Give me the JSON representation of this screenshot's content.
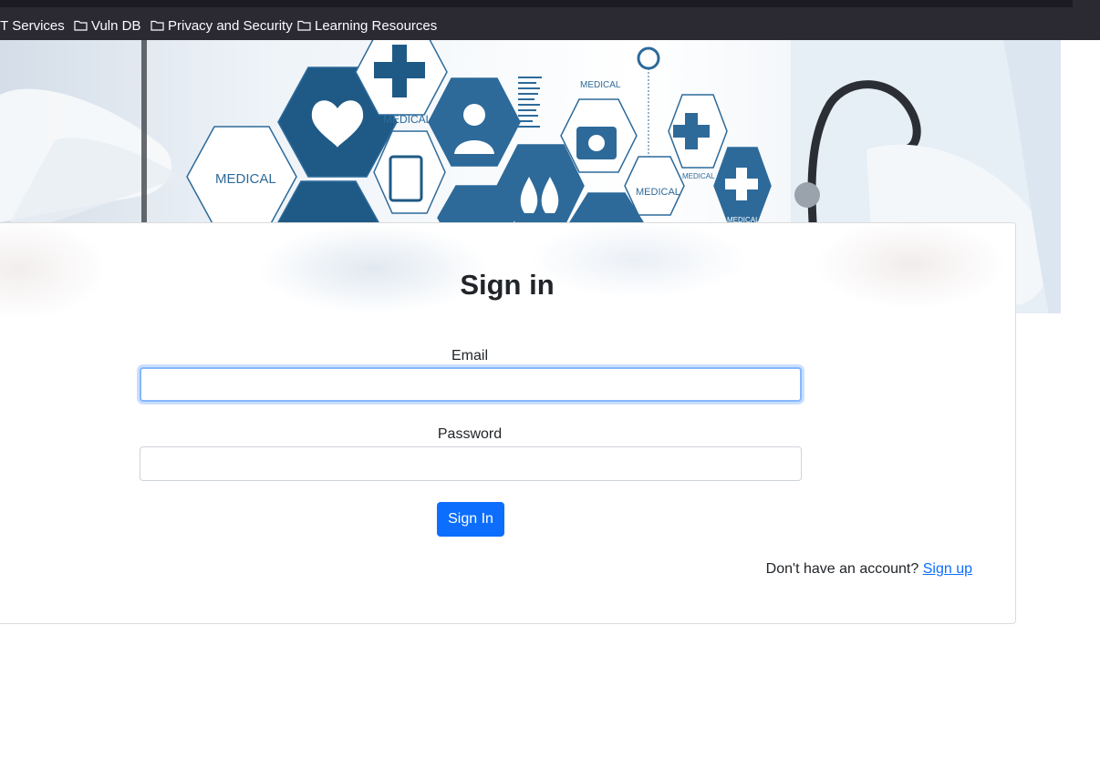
{
  "bookmarks": [
    {
      "label": "IT Services",
      "icon": "folder-icon"
    },
    {
      "label": "Vuln DB",
      "icon": "folder-icon"
    },
    {
      "label": "Privacy and Security",
      "icon": "folder-icon"
    },
    {
      "label": "Learning Resources",
      "icon": "folder-icon"
    }
  ],
  "banner": {
    "hex_labels": [
      "MEDICAL",
      "MEDICAL",
      "MEDICAL",
      "MEDICAL",
      "MEDICAL",
      "MEDICAL"
    ]
  },
  "form": {
    "title": "Sign in",
    "email_label": "Email",
    "email_value": "",
    "password_label": "Password",
    "password_value": "",
    "submit_label": "Sign In",
    "signup_prompt": "Don't have an account?",
    "signup_link": "Sign up"
  },
  "colors": {
    "primary": "#0d6efd",
    "bookmarks_bg": "#2b2a33",
    "focus_ring": "#86b7fe",
    "medical_blue": "#2d6a9a"
  }
}
